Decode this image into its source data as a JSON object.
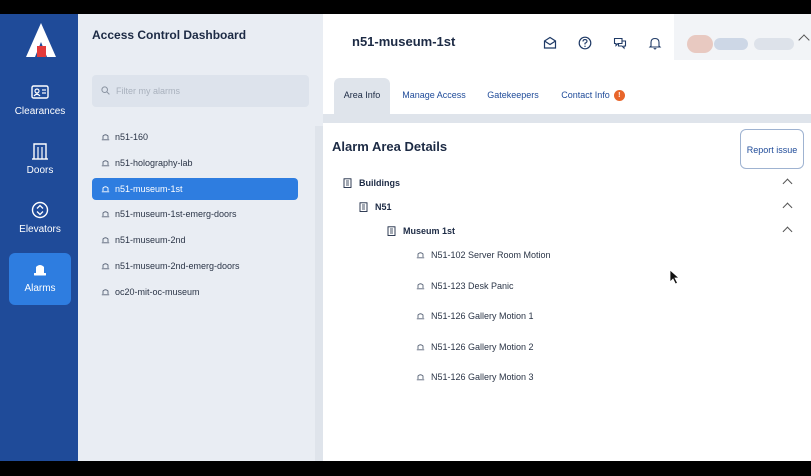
{
  "nav": {
    "logo": "A",
    "items": [
      {
        "label": "Clearances",
        "icon": "id-card-icon"
      },
      {
        "label": "Doors",
        "icon": "building-icon"
      },
      {
        "label": "Elevators",
        "icon": "elevator-icon"
      },
      {
        "label": "Alarms",
        "icon": "alarm-icon",
        "active": true
      }
    ]
  },
  "sidebar": {
    "title": "Access Control Dashboard",
    "filter_placeholder": "Filter my alarms",
    "alarms": [
      "n51-160",
      "n51-holography-lab",
      "n51-museum-1st",
      "n51-museum-1st-emerg-doors",
      "n51-museum-2nd",
      "n51-museum-2nd-emerg-doors",
      "oc20-mit-oc-museum"
    ],
    "selected": "n51-museum-1st"
  },
  "header": {
    "title": "n51-museum-1st",
    "icons": [
      "mail-icon",
      "help-icon",
      "chat-icon",
      "bell-icon"
    ]
  },
  "tabs": [
    {
      "label": "Area Info",
      "active": true
    },
    {
      "label": "Manage Access"
    },
    {
      "label": "Gatekeepers"
    },
    {
      "label": "Contact Info",
      "badge": "!"
    }
  ],
  "details": {
    "title": "Alarm Area Details",
    "report_label": "Report issue",
    "tree": {
      "root": "Buildings",
      "building": "N51",
      "floor": "Museum 1st",
      "devices": [
        "N51-102 Server Room Motion",
        "N51-123 Desk Panic",
        "N51-126 Gallery Motion 1",
        "N51-126 Gallery Motion 2",
        "N51-126 Gallery Motion 3"
      ]
    }
  },
  "colors": {
    "nav_bg": "#1f4b99",
    "accent": "#2e7de0",
    "badge": "#e8652a"
  }
}
